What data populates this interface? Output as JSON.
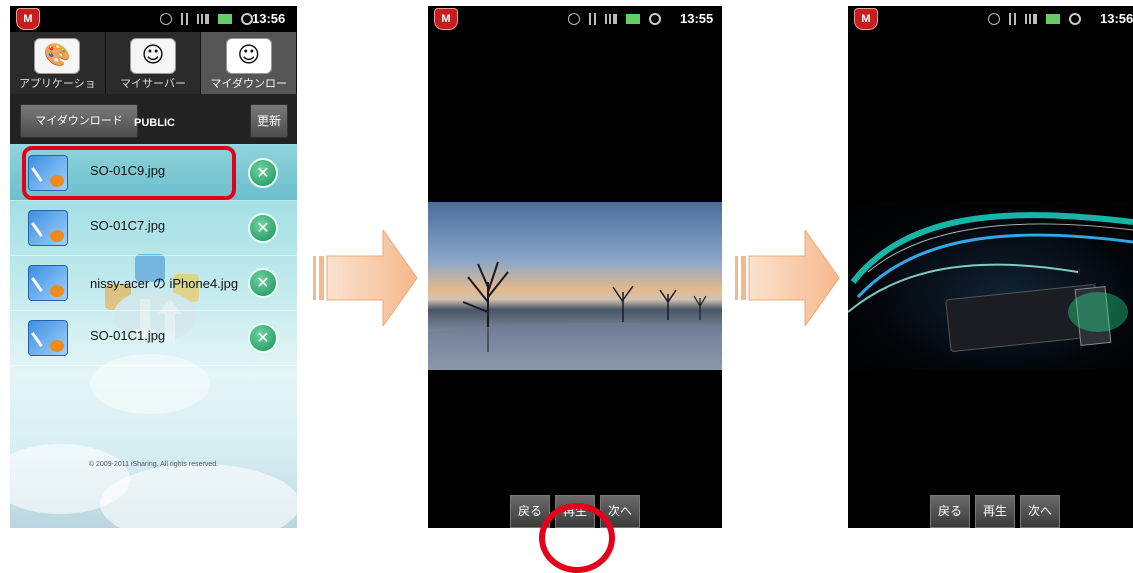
{
  "phone1": {
    "status": {
      "time": "13:56"
    },
    "tabs": [
      {
        "label": "アプリケーショ",
        "icon": "palette-icon"
      },
      {
        "label": "マイサーバー",
        "icon": "smiley-icon"
      },
      {
        "label": "マイダウンロー",
        "icon": "smiley-network-icon",
        "active": true
      }
    ],
    "toolbar": {
      "download_label": "マイダウンロード",
      "folder_label": "PUBLIC",
      "refresh_label": "更新"
    },
    "files": [
      {
        "name": "SO-01C9.jpg",
        "selected": true
      },
      {
        "name": "SO-01C7.jpg"
      },
      {
        "name": "nissy-acer の iPhone4.jpg"
      },
      {
        "name": "SO-01C1.jpg"
      }
    ],
    "copyright": "© 2009-2011 iSharing. All rights reserved."
  },
  "phone2": {
    "status": {
      "time": "13:55"
    },
    "controls": {
      "back": "戻る",
      "play": "再生",
      "next": "次へ"
    }
  },
  "phone3": {
    "status": {
      "time": "13:56"
    },
    "controls": {
      "back": "戻る",
      "play": "再生",
      "next": "次へ"
    }
  },
  "colors": {
    "highlight": "#e3001b",
    "arrow": "#f6b98a"
  }
}
